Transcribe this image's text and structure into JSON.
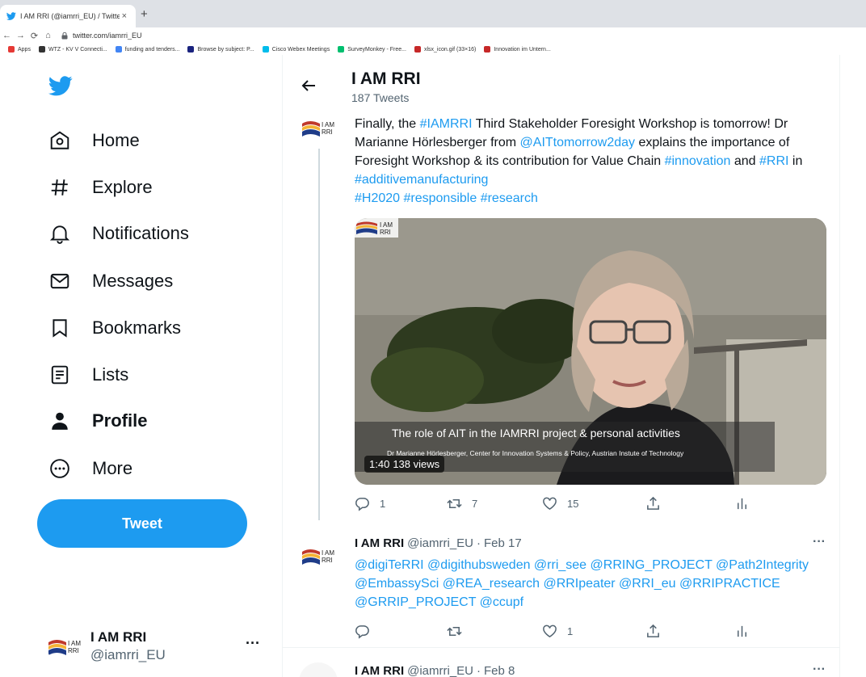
{
  "browser": {
    "tab_title": "I AM RRI (@iamrri_EU) / Twitter",
    "tab_close": "×",
    "new_tab": "+",
    "url": "twitter.com/iamrri_EU",
    "bookmarks": [
      {
        "label": "Apps",
        "color": "#e53935"
      },
      {
        "label": "WTZ - KV V Connecti...",
        "color": "#333333"
      },
      {
        "label": "funding and tenders...",
        "color": "#4285f4"
      },
      {
        "label": "Browse by subject: P...",
        "color": "#1a237e"
      },
      {
        "label": "Cisco Webex Meetings",
        "color": "#00bceb"
      },
      {
        "label": "SurveyMonkey - Free...",
        "color": "#00bf6f"
      },
      {
        "label": "xlsx_icon.gif (33×16)",
        "color": "#c62828"
      },
      {
        "label": "Innovation im Untern...",
        "color": "#c62828"
      }
    ]
  },
  "sidebar": {
    "nav": [
      {
        "label": "Home",
        "icon": "home-icon"
      },
      {
        "label": "Explore",
        "icon": "hashtag-icon"
      },
      {
        "label": "Notifications",
        "icon": "bell-icon"
      },
      {
        "label": "Messages",
        "icon": "envelope-icon"
      },
      {
        "label": "Bookmarks",
        "icon": "bookmark-icon"
      },
      {
        "label": "Lists",
        "icon": "list-icon"
      },
      {
        "label": "Profile",
        "icon": "person-icon"
      },
      {
        "label": "More",
        "icon": "more-circle-icon"
      }
    ],
    "tweet_button": "Tweet",
    "account": {
      "name": "I AM RRI",
      "handle": "@iamrri_EU",
      "more": "···"
    }
  },
  "header": {
    "title": "I AM RRI",
    "tweet_count": "187 Tweets"
  },
  "tweet1": {
    "text": [
      {
        "t": "Finally, the ",
        "link": false
      },
      {
        "t": "#IAMRRI",
        "link": true
      },
      {
        "t": " Third Stakeholder Foresight Workshop is tomorrow! Dr Marianne Hörlesberger from ",
        "link": false
      },
      {
        "t": "@AITtomorrow2day",
        "link": true
      },
      {
        "t": " explains the importance of Foresight Workshop & its contribution for Value Chain ",
        "link": false
      },
      {
        "t": "#innovation",
        "link": true
      },
      {
        "t": "  and ",
        "link": false
      },
      {
        "t": "#RRI",
        "link": true
      },
      {
        "t": " in ",
        "link": false
      },
      {
        "t": "#additivemanufacturing",
        "link": true
      },
      {
        "t": "\n",
        "link": false
      },
      {
        "t": "#H2020",
        "link": true
      },
      {
        "t": " ",
        "link": false
      },
      {
        "t": "#responsible",
        "link": true
      },
      {
        "t": " ",
        "link": false
      },
      {
        "t": "#research",
        "link": true
      }
    ],
    "video": {
      "caption": "The role of AIT  in the IAMRRI project & personal activities",
      "subcaption": "Dr Marianne Hörlesberger, Center for Innovation Systems & Policy, Austrian Instute of Technology",
      "duration": "1:40",
      "views": "138 views",
      "logo_text_1": "I AM",
      "logo_text_2": "RRI"
    },
    "replies": "1",
    "retweets": "7",
    "likes": "15"
  },
  "tweet2": {
    "name": "I AM RRI",
    "handle": "@iamrri_EU",
    "sep": "·",
    "date": "Feb 17",
    "more": "···",
    "text": "@digiTeRRI @digithubsweden @rri_see @RRING_PROJECT @Path2Integrity @EmbassySci @REA_research @RRIpeater @RRI_eu @RRIPRACTICE @GRRIP_PROJECT @ccupf",
    "likes": "1"
  },
  "tweet3": {
    "name": "I AM RRI",
    "handle": "@iamrri_EU",
    "sep": "·",
    "date": "Feb 8",
    "more": "···"
  },
  "logo_text": {
    "line1": "I AM",
    "line2": "RRI"
  },
  "colors": {
    "accent": "#1d9bf0",
    "text": "#0f1419",
    "muted": "#536471",
    "logo_red": "#c0392b",
    "logo_blue": "#1f3c88",
    "logo_yellow": "#f5b335"
  }
}
